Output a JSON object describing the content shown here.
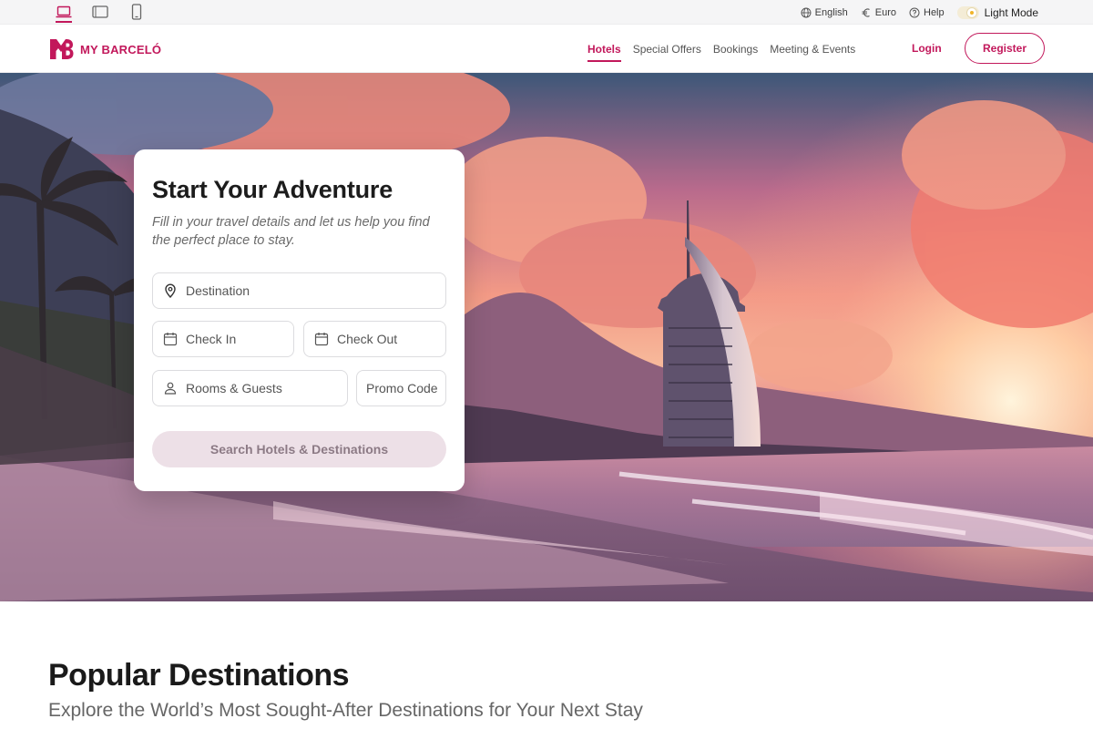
{
  "utility_bar": {
    "device_views": [
      {
        "name": "desktop",
        "icon": "laptop-icon",
        "active": true
      },
      {
        "name": "tablet",
        "icon": "tablet-icon",
        "active": false
      },
      {
        "name": "mobile",
        "icon": "mobile-phone-icon",
        "active": false
      }
    ],
    "language": "English",
    "currency": "Euro",
    "help": "Help",
    "theme_mode": "Light Mode"
  },
  "nav": {
    "logo_text": "MY BARCELÓ",
    "links": [
      {
        "label": "Hotels",
        "active": true
      },
      {
        "label": "Special Offers",
        "active": false
      },
      {
        "label": "Bookings",
        "active": false
      },
      {
        "label": "Meeting & Events",
        "active": false
      }
    ],
    "login": "Login",
    "register": "Register"
  },
  "search_card": {
    "title": "Start Your Adventure",
    "subtitle": "Fill in your travel details and let us help you find the perfect place to stay.",
    "destination_placeholder": "Destination",
    "checkin_placeholder": "Check In",
    "checkout_placeholder": "Check Out",
    "rooms_placeholder": "Rooms & Guests",
    "promo_placeholder": "Promo Code",
    "search_button": "Search Hotels & Destinations"
  },
  "popular": {
    "title": "Popular Destinations",
    "subtitle": "Explore the World’s Most Sought-After Destinations for Your Next Stay"
  },
  "colors": {
    "brand": "#c2185b",
    "search_button_bg": "#ede0e7",
    "search_button_text": "#8c7a85"
  }
}
